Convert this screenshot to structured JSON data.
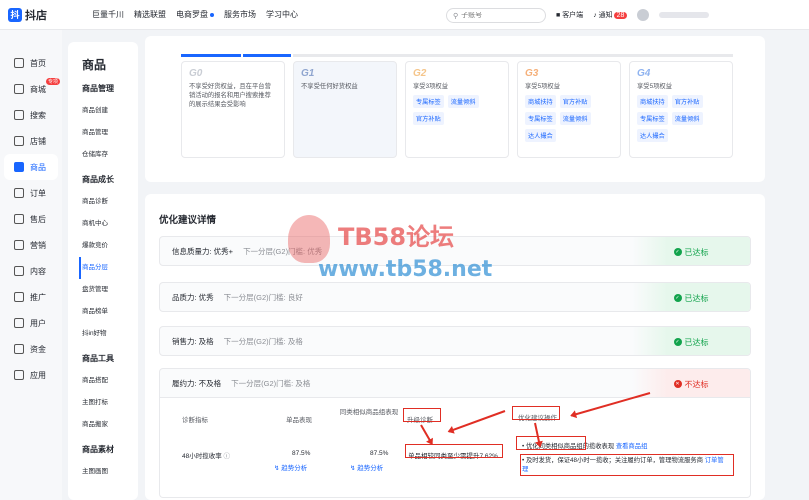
{
  "topbar": {
    "logo_text": "抖店",
    "nav": [
      "巨量千川",
      "精选联盟",
      "电商罗盘",
      "服务市场",
      "学习中心"
    ],
    "search_placeholder": "子账号",
    "service_label": "客户端",
    "notice_label": "通知",
    "notice_count": "28"
  },
  "sidebar": {
    "items": [
      {
        "label": "首页"
      },
      {
        "label": "商城",
        "badge": "专项"
      },
      {
        "label": "搜索"
      },
      {
        "label": "店铺"
      },
      {
        "label": "商品",
        "active": true
      },
      {
        "label": "订单"
      },
      {
        "label": "售后"
      },
      {
        "label": "营销"
      },
      {
        "label": "内容"
      },
      {
        "label": "推广"
      },
      {
        "label": "用户"
      },
      {
        "label": "资金"
      },
      {
        "label": "应用"
      }
    ]
  },
  "subnav": {
    "title": "商品",
    "groups": [
      {
        "label": "商品管理",
        "links": [
          "商品创建",
          "商品管理",
          "仓储库存"
        ]
      },
      {
        "label": "商品成长",
        "links": [
          "商品诊断",
          "商机中心",
          "爆款竞价",
          "商品分层",
          "盘货管理",
          "商品榜单",
          "抖in好物"
        ]
      },
      {
        "label": "商品工具",
        "links": [
          "商品搭配",
          "主图打标",
          "商品搬家"
        ]
      },
      {
        "label": "商品素材",
        "links": [
          "主图画图"
        ]
      }
    ],
    "active_link": "商品分层"
  },
  "tiers": [
    {
      "name": "G0",
      "desc": "不享受好货权益，且在平台营销活动的报名和用户搜索推荐的展示结果会受影响",
      "tags": []
    },
    {
      "name": "G1",
      "desc": "不享受任何好货权益",
      "tags": [],
      "current": true
    },
    {
      "name": "G2",
      "desc": "享受3项权益",
      "tags": [
        "专属标签",
        "流量倾斜",
        "官方补贴"
      ]
    },
    {
      "name": "G3",
      "desc": "享受5项权益",
      "tags": [
        "商城扶持",
        "官方补贴",
        "专属标签",
        "流量倾斜",
        "达人撮合"
      ]
    },
    {
      "name": "G4",
      "desc": "享受5项权益",
      "tags": [
        "商城扶持",
        "官方补贴",
        "专属标签",
        "流量倾斜",
        "达人撮合"
      ]
    }
  ],
  "optimize": {
    "title": "优化建议详情",
    "rows": [
      {
        "label": "信息质量力: 优秀+",
        "next": "下一分层(G2)门槛: 优秀",
        "status": "已达标",
        "ok": true
      },
      {
        "label": "品质力: 优秀",
        "next": "下一分层(G2)门槛: 良好",
        "status": "已达标",
        "ok": true
      },
      {
        "label": "销售力: 及格",
        "next": "下一分层(G2)门槛: 及格",
        "status": "已达标",
        "ok": true
      },
      {
        "label": "履约力: 不及格",
        "next": "下一分层(G2)门槛: 及格",
        "status": "不达标",
        "ok": false
      }
    ],
    "detail": {
      "headers": [
        "诊断指标",
        "单品表现",
        "同类相似商品组表现",
        "升级诊断",
        "优化建议操作"
      ],
      "metric": "48小时揽收率",
      "single_value": "87.5%",
      "group_value": "87.5%",
      "trend_link": "趋势分析",
      "diagnosis": "单品相较同类至少需提升7.62%",
      "suggestion_1": "优化同类相似商品组的揽收表现",
      "suggestion_1_link": "查看商品组",
      "suggestion_2": "及时发货，保证48小时一揽收；关注履约订单，管理物流服务商",
      "suggestion_2_link": "订单管理"
    }
  },
  "watermark": {
    "title": "TB58论坛",
    "url": "www.tb58.net"
  },
  "colors": {
    "brand": "#1966ff",
    "ok": "#12a34c",
    "bad": "#e02e24"
  }
}
